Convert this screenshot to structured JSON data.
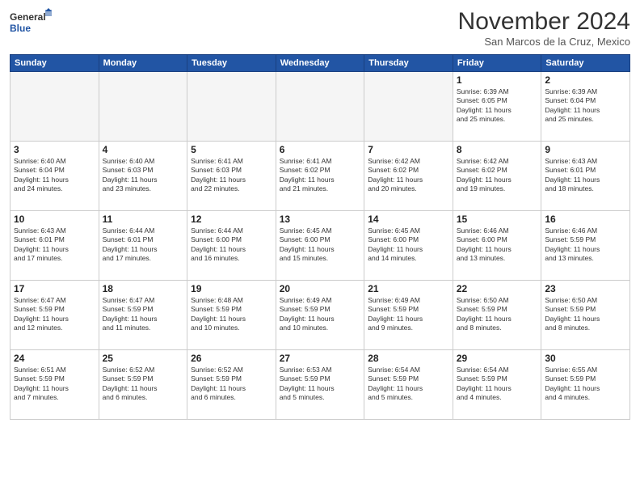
{
  "header": {
    "logo_line1": "General",
    "logo_line2": "Blue",
    "month": "November 2024",
    "location": "San Marcos de la Cruz, Mexico"
  },
  "weekdays": [
    "Sunday",
    "Monday",
    "Tuesday",
    "Wednesday",
    "Thursday",
    "Friday",
    "Saturday"
  ],
  "weeks": [
    [
      {
        "day": "",
        "text": ""
      },
      {
        "day": "",
        "text": ""
      },
      {
        "day": "",
        "text": ""
      },
      {
        "day": "",
        "text": ""
      },
      {
        "day": "",
        "text": ""
      },
      {
        "day": "1",
        "text": "Sunrise: 6:39 AM\nSunset: 6:05 PM\nDaylight: 11 hours\nand 25 minutes."
      },
      {
        "day": "2",
        "text": "Sunrise: 6:39 AM\nSunset: 6:04 PM\nDaylight: 11 hours\nand 25 minutes."
      }
    ],
    [
      {
        "day": "3",
        "text": "Sunrise: 6:40 AM\nSunset: 6:04 PM\nDaylight: 11 hours\nand 24 minutes."
      },
      {
        "day": "4",
        "text": "Sunrise: 6:40 AM\nSunset: 6:03 PM\nDaylight: 11 hours\nand 23 minutes."
      },
      {
        "day": "5",
        "text": "Sunrise: 6:41 AM\nSunset: 6:03 PM\nDaylight: 11 hours\nand 22 minutes."
      },
      {
        "day": "6",
        "text": "Sunrise: 6:41 AM\nSunset: 6:02 PM\nDaylight: 11 hours\nand 21 minutes."
      },
      {
        "day": "7",
        "text": "Sunrise: 6:42 AM\nSunset: 6:02 PM\nDaylight: 11 hours\nand 20 minutes."
      },
      {
        "day": "8",
        "text": "Sunrise: 6:42 AM\nSunset: 6:02 PM\nDaylight: 11 hours\nand 19 minutes."
      },
      {
        "day": "9",
        "text": "Sunrise: 6:43 AM\nSunset: 6:01 PM\nDaylight: 11 hours\nand 18 minutes."
      }
    ],
    [
      {
        "day": "10",
        "text": "Sunrise: 6:43 AM\nSunset: 6:01 PM\nDaylight: 11 hours\nand 17 minutes."
      },
      {
        "day": "11",
        "text": "Sunrise: 6:44 AM\nSunset: 6:01 PM\nDaylight: 11 hours\nand 17 minutes."
      },
      {
        "day": "12",
        "text": "Sunrise: 6:44 AM\nSunset: 6:00 PM\nDaylight: 11 hours\nand 16 minutes."
      },
      {
        "day": "13",
        "text": "Sunrise: 6:45 AM\nSunset: 6:00 PM\nDaylight: 11 hours\nand 15 minutes."
      },
      {
        "day": "14",
        "text": "Sunrise: 6:45 AM\nSunset: 6:00 PM\nDaylight: 11 hours\nand 14 minutes."
      },
      {
        "day": "15",
        "text": "Sunrise: 6:46 AM\nSunset: 6:00 PM\nDaylight: 11 hours\nand 13 minutes."
      },
      {
        "day": "16",
        "text": "Sunrise: 6:46 AM\nSunset: 5:59 PM\nDaylight: 11 hours\nand 13 minutes."
      }
    ],
    [
      {
        "day": "17",
        "text": "Sunrise: 6:47 AM\nSunset: 5:59 PM\nDaylight: 11 hours\nand 12 minutes."
      },
      {
        "day": "18",
        "text": "Sunrise: 6:47 AM\nSunset: 5:59 PM\nDaylight: 11 hours\nand 11 minutes."
      },
      {
        "day": "19",
        "text": "Sunrise: 6:48 AM\nSunset: 5:59 PM\nDaylight: 11 hours\nand 10 minutes."
      },
      {
        "day": "20",
        "text": "Sunrise: 6:49 AM\nSunset: 5:59 PM\nDaylight: 11 hours\nand 10 minutes."
      },
      {
        "day": "21",
        "text": "Sunrise: 6:49 AM\nSunset: 5:59 PM\nDaylight: 11 hours\nand 9 minutes."
      },
      {
        "day": "22",
        "text": "Sunrise: 6:50 AM\nSunset: 5:59 PM\nDaylight: 11 hours\nand 8 minutes."
      },
      {
        "day": "23",
        "text": "Sunrise: 6:50 AM\nSunset: 5:59 PM\nDaylight: 11 hours\nand 8 minutes."
      }
    ],
    [
      {
        "day": "24",
        "text": "Sunrise: 6:51 AM\nSunset: 5:59 PM\nDaylight: 11 hours\nand 7 minutes."
      },
      {
        "day": "25",
        "text": "Sunrise: 6:52 AM\nSunset: 5:59 PM\nDaylight: 11 hours\nand 6 minutes."
      },
      {
        "day": "26",
        "text": "Sunrise: 6:52 AM\nSunset: 5:59 PM\nDaylight: 11 hours\nand 6 minutes."
      },
      {
        "day": "27",
        "text": "Sunrise: 6:53 AM\nSunset: 5:59 PM\nDaylight: 11 hours\nand 5 minutes."
      },
      {
        "day": "28",
        "text": "Sunrise: 6:54 AM\nSunset: 5:59 PM\nDaylight: 11 hours\nand 5 minutes."
      },
      {
        "day": "29",
        "text": "Sunrise: 6:54 AM\nSunset: 5:59 PM\nDaylight: 11 hours\nand 4 minutes."
      },
      {
        "day": "30",
        "text": "Sunrise: 6:55 AM\nSunset: 5:59 PM\nDaylight: 11 hours\nand 4 minutes."
      }
    ]
  ]
}
